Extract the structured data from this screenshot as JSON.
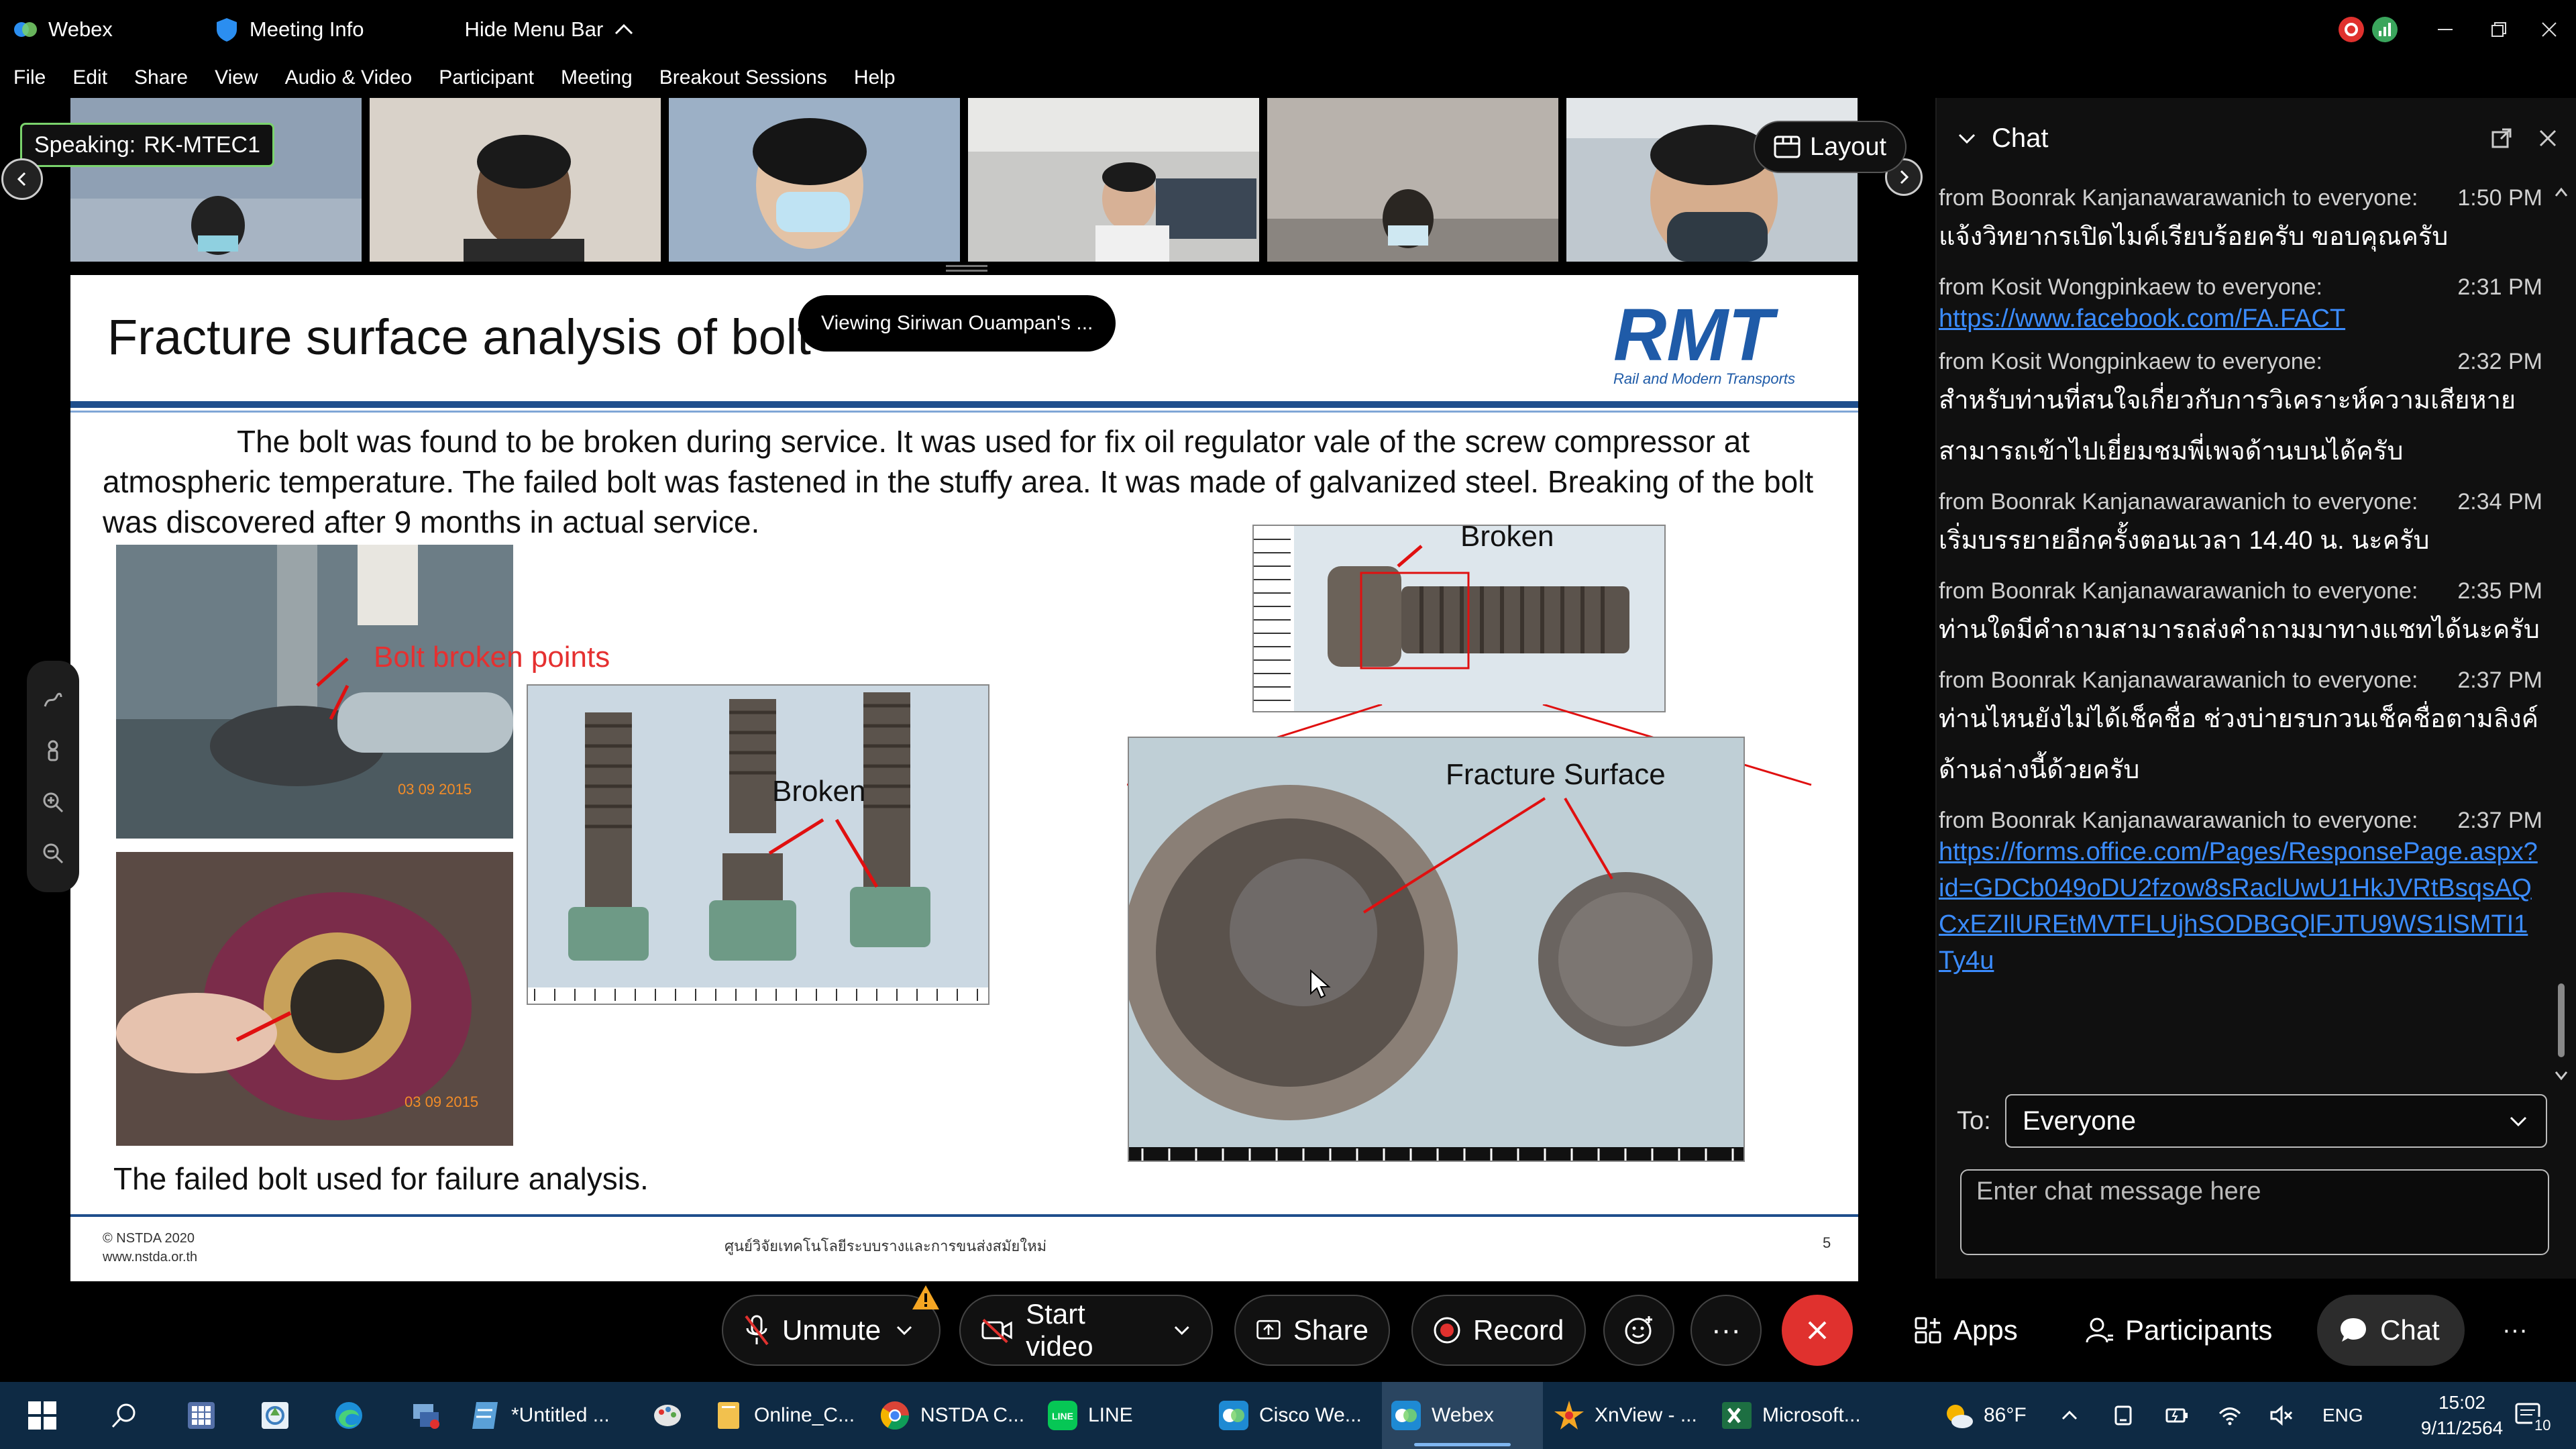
{
  "titlebar": {
    "app_name": "Webex",
    "meeting_info": "Meeting Info",
    "hide_menu_bar": "Hide Menu Bar"
  },
  "menu": [
    "File",
    "Edit",
    "Share",
    "View",
    "Audio & Video",
    "Participant",
    "Meeting",
    "Breakout Sessions",
    "Help"
  ],
  "video_strip": {
    "speaking_label": "Speaking:",
    "speaking_name": "RK-MTEC1",
    "layout_label": "Layout"
  },
  "slide": {
    "viewing_notice": "Viewing Siriwan Ouampan's ...",
    "title": "Fracture surface analysis of bolt",
    "logo_text": "RMT",
    "logo_sub": "Rail and Modern Transports",
    "body": "The bolt was found to be broken during service. It was used for fix oil regulator vale of the screw compressor at atmospheric temperature. The failed bolt was fastened in the stuffy area. It was made of galvanized steel. Breaking of the bolt was discovered after 9 months in actual service.",
    "label_bolt_broken_points": "Bolt  broken points",
    "label_broken_1": "Broken",
    "label_broken_2": "Broken",
    "label_fracture_surface": "Fracture Surface",
    "photo_date_1": "03 09 2015",
    "photo_date_2": "03 09 2015",
    "caption": "The failed bolt used for failure analysis.",
    "footer_copyright": "© NSTDA 2020",
    "footer_url": "www.nstda.or.th",
    "footer_center": "ศูนย์วิจัยเทคโนโลยีระบบรางและการขนส่งสมัยใหม่",
    "page_number": "5"
  },
  "chat": {
    "title": "Chat",
    "messages": [
      {
        "meta": "from Boonrak Kanjanawarawanich to everyone:",
        "time": "1:50 PM",
        "text": "แจ้งวิทยากรเปิดไมค์เรียบร้อยครับ ขอบคุณครับ",
        "link": ""
      },
      {
        "meta": "from Kosit Wongpinkaew to everyone:",
        "time": "2:31 PM",
        "text": "",
        "link": "https://www.facebook.com/FA.FACT"
      },
      {
        "meta": "from Kosit Wongpinkaew to everyone:",
        "time": "2:32 PM",
        "text": "สำหรับท่านที่สนใจเกี่ยวกับการวิเคราะห์ความเสียหาย สามารถเข้าไปเยี่ยมชมพี่เพจด้านบนได้ครับ",
        "link": ""
      },
      {
        "meta": "from Boonrak Kanjanawarawanich to everyone:",
        "time": "2:34 PM",
        "text": "เริ่มบรรยายอีกครั้งตอนเวลา 14.40 น. นะครับ",
        "link": ""
      },
      {
        "meta": "from Boonrak Kanjanawarawanich to everyone:",
        "time": "2:35 PM",
        "text": "ท่านใดมีคำถามสามารถส่งคำถามมาทางแชทได้นะครับ",
        "link": ""
      },
      {
        "meta": "from Boonrak Kanjanawarawanich to everyone:",
        "time": "2:37 PM",
        "text": "ท่านไหนยังไม่ได้เช็คชื่อ ช่วงบ่ายรบกวนเช็คชื่อตามลิงค์ด้านล่างนี้ด้วยครับ",
        "link": ""
      },
      {
        "meta": "from Boonrak Kanjanawarawanich to everyone:",
        "time": "2:37 PM",
        "text": "",
        "link": "https://forms.office.com/Pages/ResponsePage.aspx?id=GDCb049oDU2fzow8sRaclUwU1HkJVRtBsqsAQCxEZIlUREtMVTFLUjhSODBGQlFJTU9WS1lSMTI1Ty4u"
      }
    ],
    "to_label": "To:",
    "to_value": "Everyone",
    "input_placeholder": "Enter chat message here"
  },
  "controls": {
    "unmute": "Unmute",
    "start_video": "Start video",
    "share": "Share",
    "record": "Record",
    "more": "···",
    "apps": "Apps",
    "participants": "Participants",
    "chat": "Chat",
    "overflow": "···"
  },
  "taskbar": {
    "apps": [
      {
        "label": "*Untitled ...",
        "icon": "notepad-icon",
        "color": "#5aa0d8"
      },
      {
        "label": "Online_C...",
        "icon": "folder-icon",
        "color": "#f2c14e"
      },
      {
        "label": "NSTDA C...",
        "icon": "chrome-icon",
        "color": "#db4437"
      },
      {
        "label": "LINE",
        "icon": "line-icon",
        "color": "#06c755"
      },
      {
        "label": "Cisco We...",
        "icon": "cisco-webex-icon",
        "color": "#1e8ad3"
      },
      {
        "label": "Webex",
        "icon": "webex-icon",
        "color": "#1e8ad3"
      },
      {
        "label": "XnView - ...",
        "icon": "xnview-icon",
        "color": "#f5a623"
      },
      {
        "label": "Microsoft...",
        "icon": "excel-icon",
        "color": "#1d6f42"
      }
    ],
    "weather": "86°F",
    "language": "ENG",
    "time": "15:02",
    "date": "9/11/2564",
    "notification_count": "10"
  },
  "colors": {
    "accent_blue": "#1f4e8c",
    "link": "#3b8cff",
    "end_call": "#e0312e",
    "speaking_border": "#7ad36c",
    "taskbar": "#0e2a44"
  }
}
